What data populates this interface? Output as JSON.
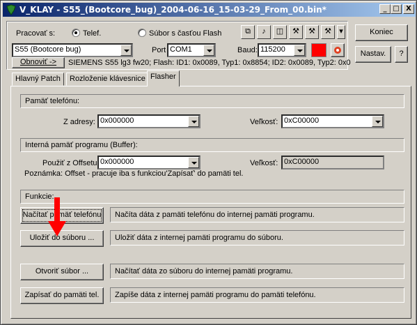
{
  "title": "V_KLAY - S55_(Bootcore_bug)_2004-06-16_15-03-29_From_00.bin*",
  "titlebar": {
    "minimize": "_",
    "maximize": "□",
    "close": "X"
  },
  "top": {
    "pracovat_label": "Pracovať s:",
    "radio_telef": "Telef.",
    "radio_subor": "Súbor s časťou Flash",
    "phone_model": "S55 (Bootcore bug)",
    "port_label": "Port",
    "port_value": "COM1",
    "baud_label": "Baud:",
    "baud_value": "115200",
    "obnovit": "Obnoviť ->",
    "info_line": "SIEMENS S55 lg3 fw20; Flash: ID1: 0x0089, Typ1: 0x8854; ID2: 0x0089, Typ2: 0x0",
    "koniec": "Koniec",
    "nastav": "Nastav.",
    "help": "?",
    "status_color": "#ff0000"
  },
  "tabs": [
    {
      "label": "Hlavný Patch"
    },
    {
      "label": "Rozloženie klávesnice"
    },
    {
      "label": "Flasher"
    }
  ],
  "flasher": {
    "pamat_header": "Pamäť telefónu:",
    "z_adresy_label": "Z adresy:",
    "z_adresy_value": "0x000000",
    "velkost_label": "Veľkosť:",
    "velkost_value": "0xC00000",
    "interna_header": "Interná pamäť programu (Buffer):",
    "offset_label": "Použiť z Offsetu:",
    "offset_value": "0x000000",
    "velkost2_label": "Veľkosť:",
    "velkost2_value": "0xC00000",
    "poznamka": "Poznámka: Offset - pracuje iba s funkciou'Zapísať' do pamäti tel.",
    "funkcie_header": "Funkcie:",
    "actions": [
      {
        "button": "Načítať pamäť telefónu",
        "desc": "Načíta dáta z pamäti telefónu do internej pamäti programu."
      },
      {
        "button": "Uložiť do súboru ...",
        "desc": "Uložiť dáta z internej pamäti programu do súboru."
      },
      {
        "button": "Otvoriť súbor ...",
        "desc": "Načítať dáta zo súboru do internej pamäti programu."
      },
      {
        "button": "Zapísať do pamäti tel.",
        "desc": "Zapíše dáta z internej pamäti programu do pamäti telefónu."
      }
    ]
  }
}
